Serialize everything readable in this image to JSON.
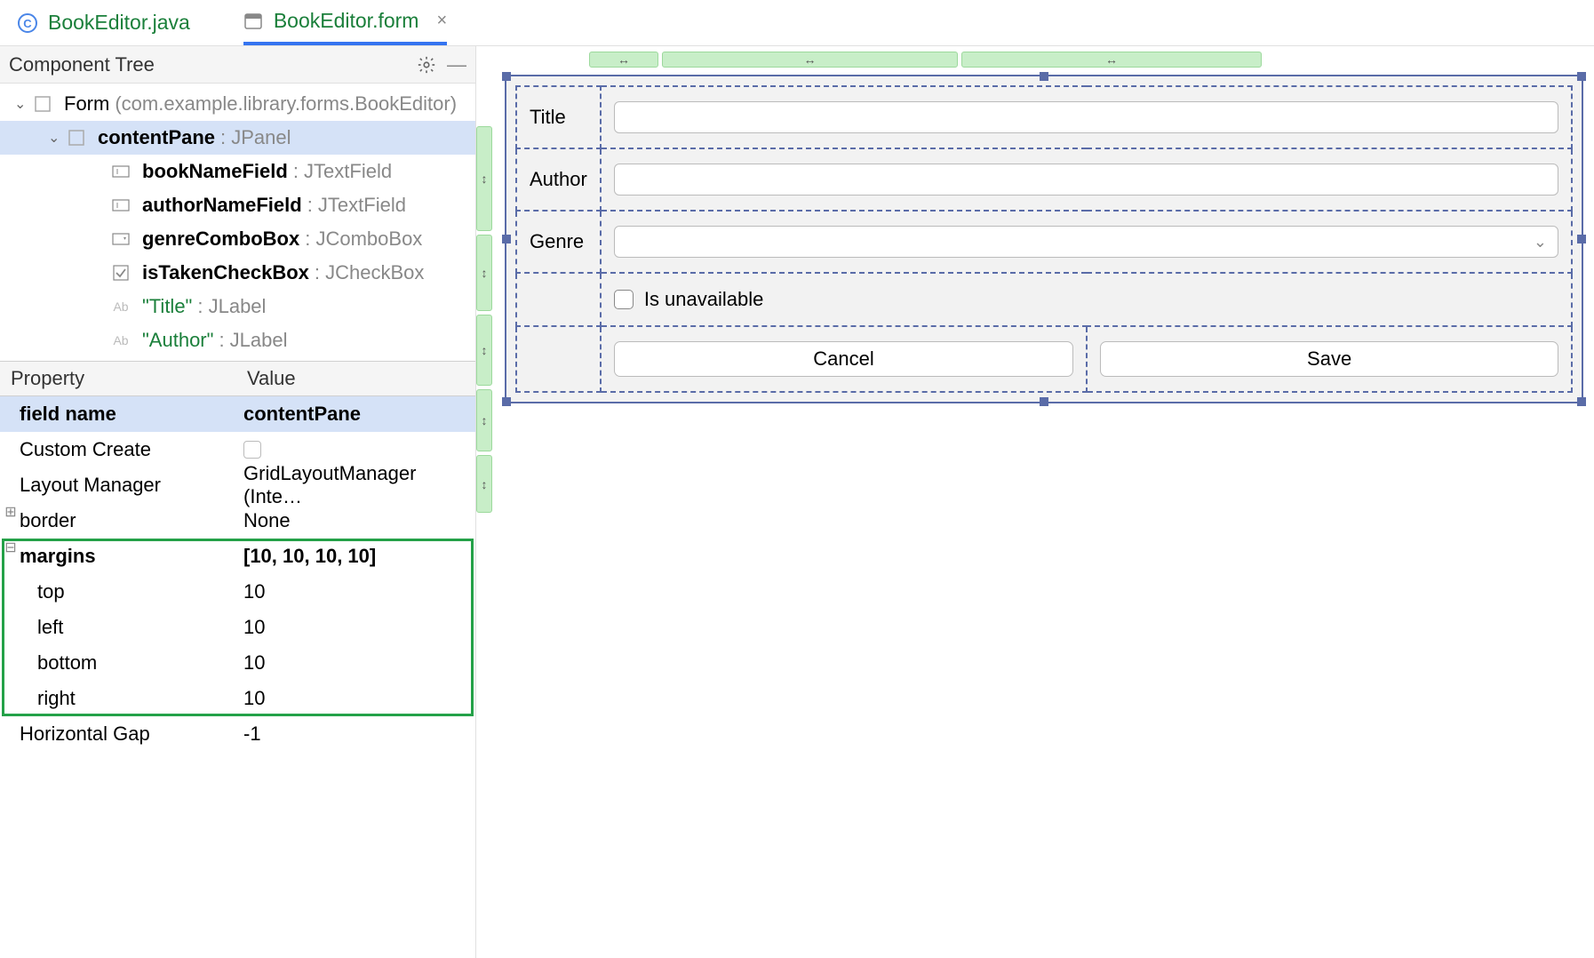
{
  "tabs": [
    {
      "label": "BookEditor.java",
      "active": false
    },
    {
      "label": "BookEditor.form",
      "active": true
    }
  ],
  "componentTree": {
    "title": "Component Tree",
    "root": {
      "name": "Form",
      "hint": "(com.example.library.forms.BookEditor)"
    },
    "contentPane": {
      "name": "contentPane",
      "type": ": JPanel"
    },
    "children": [
      {
        "name": "bookNameField",
        "type": ": JTextField",
        "icon": "textfield"
      },
      {
        "name": "authorNameField",
        "type": ": JTextField",
        "icon": "textfield"
      },
      {
        "name": "genreComboBox",
        "type": ": JComboBox",
        "icon": "combo"
      },
      {
        "name": "isTakenCheckBox",
        "type": ": JCheckBox",
        "icon": "checkbox"
      },
      {
        "label": "\"Title\"",
        "type": ": JLabel",
        "icon": "label"
      },
      {
        "label": "\"Author\"",
        "type": ": JLabel",
        "icon": "label"
      }
    ]
  },
  "properties": {
    "header": {
      "col1": "Property",
      "col2": "Value"
    },
    "rows": {
      "fieldName": {
        "name": "field name",
        "value": "contentPane"
      },
      "customCreate": {
        "name": "Custom Create",
        "value": ""
      },
      "layoutManager": {
        "name": "Layout Manager",
        "value": "GridLayoutManager (Inte…"
      },
      "border": {
        "name": "border",
        "value": "None"
      },
      "margins": {
        "name": "margins",
        "value": "[10, 10, 10, 10]"
      },
      "marginsTop": {
        "name": "top",
        "value": "10"
      },
      "marginsLeft": {
        "name": "left",
        "value": "10"
      },
      "marginsBottom": {
        "name": "bottom",
        "value": "10"
      },
      "marginsRight": {
        "name": "right",
        "value": "10"
      },
      "horizontalGap": {
        "name": "Horizontal Gap",
        "value": "-1"
      }
    }
  },
  "form": {
    "labels": {
      "title": "Title",
      "author": "Author",
      "genre": "Genre",
      "unavailable": "Is unavailable"
    },
    "buttons": {
      "cancel": "Cancel",
      "save": "Save"
    }
  },
  "icons": {
    "vertArrow": "↕",
    "horizArrow": "↔"
  }
}
